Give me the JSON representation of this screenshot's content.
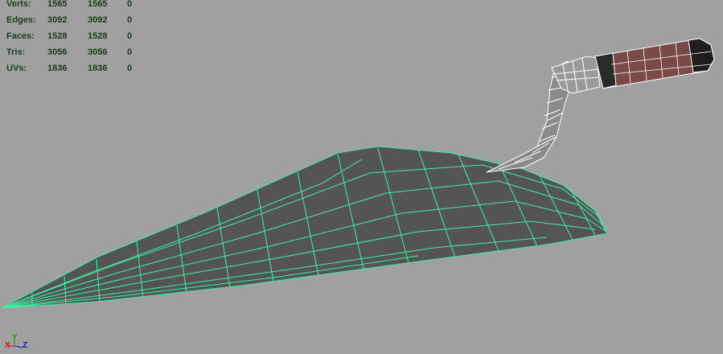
{
  "hud": {
    "rows": [
      {
        "label": "Verts:",
        "c1": "1565",
        "c2": "1565",
        "c3": "0"
      },
      {
        "label": "Edges:",
        "c1": "3092",
        "c2": "3092",
        "c3": "0"
      },
      {
        "label": "Faces:",
        "c1": "1528",
        "c2": "1528",
        "c3": "0"
      },
      {
        "label": "Tris:",
        "c1": "3056",
        "c2": "3056",
        "c3": "0"
      },
      {
        "label": "UVs:",
        "c1": "1836",
        "c2": "1836",
        "c3": "0"
      }
    ]
  },
  "axis": {
    "x": "X",
    "y": "Y",
    "z": "Z"
  },
  "colors": {
    "background": "#a0a0a0",
    "blade_wire": "#3df0a8",
    "blade_fill": "#555555",
    "handle_wire": "#ffffff",
    "handle_grip": "#7a4a48",
    "handle_dark": "#2a2a2a",
    "axis_x": "#d01010",
    "axis_y": "#10a010",
    "axis_z": "#1010d0"
  }
}
